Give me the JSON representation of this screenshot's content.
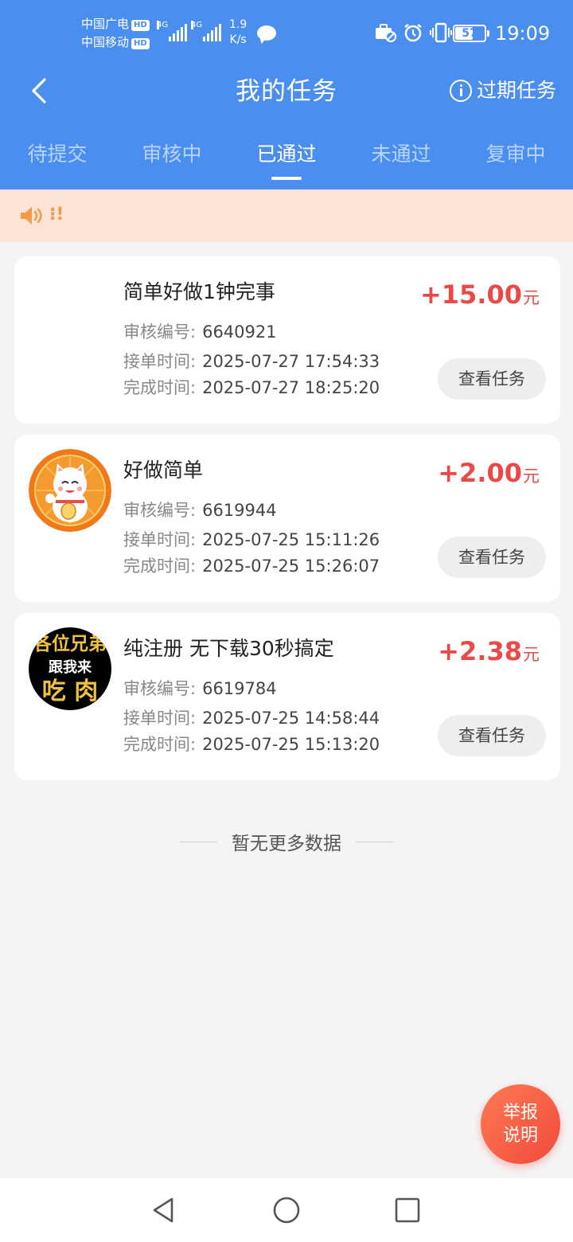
{
  "status_bar": {
    "carrier1": "中国广电",
    "carrier2": "中国移动",
    "hd": "HD",
    "net_type": "4G",
    "net_speed_value": "1.9",
    "net_speed_unit": "K/s",
    "battery": "57",
    "time": "19:09"
  },
  "header": {
    "title": "我的任务",
    "expired_label": "过期任务"
  },
  "tabs": [
    {
      "label": "待提交",
      "active": false
    },
    {
      "label": "审核中",
      "active": false
    },
    {
      "label": "已通过",
      "active": true
    },
    {
      "label": "未通过",
      "active": false
    },
    {
      "label": "复审中",
      "active": false
    }
  ],
  "notice": {
    "text": "⁝!"
  },
  "labels": {
    "review_no": "审核编号:",
    "accept_time": "接单时间:",
    "finish_time": "完成时间:",
    "view_button": "查看任务",
    "currency": "元"
  },
  "tasks": [
    {
      "name": "简单好做1钟完事",
      "amount": "+15.00",
      "review_no": "6640921",
      "accept_time": "2025-07-27 17:54:33",
      "finish_time": "2025-07-27 18:25:20",
      "avatar": "none"
    },
    {
      "name": "好做简单",
      "amount": "+2.00",
      "review_no": "6619944",
      "accept_time": "2025-07-25 15:11:26",
      "finish_time": "2025-07-25 15:26:07",
      "avatar": "lucky-cat"
    },
    {
      "name": "纯注册 无下载30秒搞定",
      "amount": "+2.38",
      "review_no": "6619784",
      "accept_time": "2025-07-25 14:58:44",
      "finish_time": "2025-07-25 15:13:20",
      "avatar": "text-logo",
      "avatar_text": [
        "各位兄弟",
        "跟我来",
        "吃 肉"
      ]
    }
  ],
  "footer": {
    "no_more": "暂无更多数据"
  },
  "fab": {
    "line1": "举报",
    "line2": "说明"
  },
  "colors": {
    "primary": "#4a8ff0",
    "price": "#e94a48",
    "notice_bg": "#fbe3d5",
    "notice_fg": "#f39b4d"
  }
}
